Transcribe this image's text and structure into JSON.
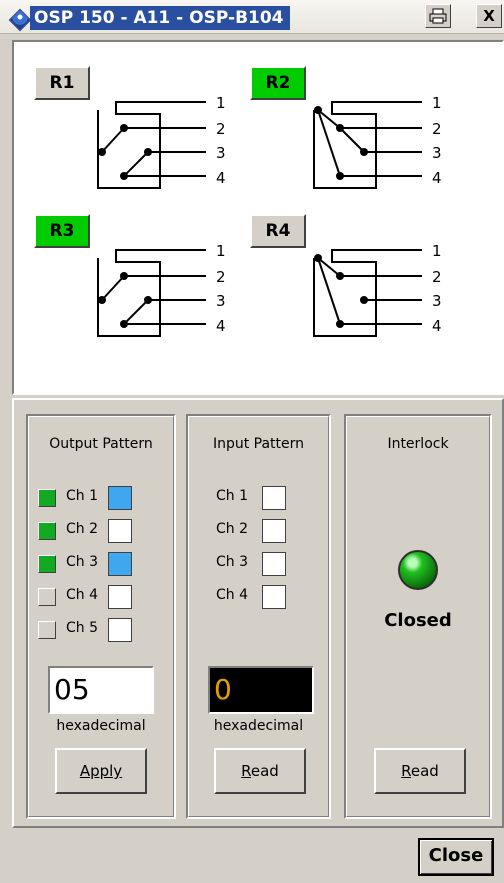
{
  "window": {
    "title": "OSP 150 - A11 - OSP-B104",
    "icons": [
      "app-diamond-icon",
      "print-icon",
      "close-icon"
    ],
    "close_glyph": "X"
  },
  "relays": [
    {
      "label": "R1",
      "active": false,
      "terminals": [
        "1",
        "2",
        "3",
        "4"
      ]
    },
    {
      "label": "R2",
      "active": true,
      "terminals": [
        "1",
        "2",
        "3",
        "4"
      ]
    },
    {
      "label": "R3",
      "active": true,
      "terminals": [
        "1",
        "2",
        "3",
        "4"
      ]
    },
    {
      "label": "R4",
      "active": false,
      "terminals": [
        "1",
        "2",
        "3",
        "4"
      ]
    }
  ],
  "output_pattern": {
    "title": "Output Pattern",
    "channels": [
      {
        "label": "Ch 1",
        "led_on": true,
        "state_on": true
      },
      {
        "label": "Ch 2",
        "led_on": true,
        "state_on": false
      },
      {
        "label": "Ch 3",
        "led_on": true,
        "state_on": true
      },
      {
        "label": "Ch 4",
        "led_on": false,
        "state_on": false
      },
      {
        "label": "Ch 5",
        "led_on": false,
        "state_on": false
      }
    ],
    "hex_value": "05",
    "hex_caption": "hexadecimal",
    "button_label": "Apply"
  },
  "input_pattern": {
    "title": "Input Pattern",
    "channels": [
      {
        "label": "Ch 1",
        "state_on": false
      },
      {
        "label": "Ch 2",
        "state_on": false
      },
      {
        "label": "Ch 3",
        "state_on": false
      },
      {
        "label": "Ch 4",
        "state_on": false
      }
    ],
    "hex_value": "0",
    "hex_caption": "hexadecimal",
    "button_label": "Read"
  },
  "interlock": {
    "title": "Interlock",
    "status": "Closed",
    "indicator_color": "#20c020",
    "button_label": "Read"
  },
  "footer": {
    "close_label": "Close"
  },
  "colors": {
    "active_green": "#00cc00",
    "channel_blue": "#3ea7ee",
    "led_green": "#11aa22",
    "hex_digit_amber": "#e0a000"
  }
}
